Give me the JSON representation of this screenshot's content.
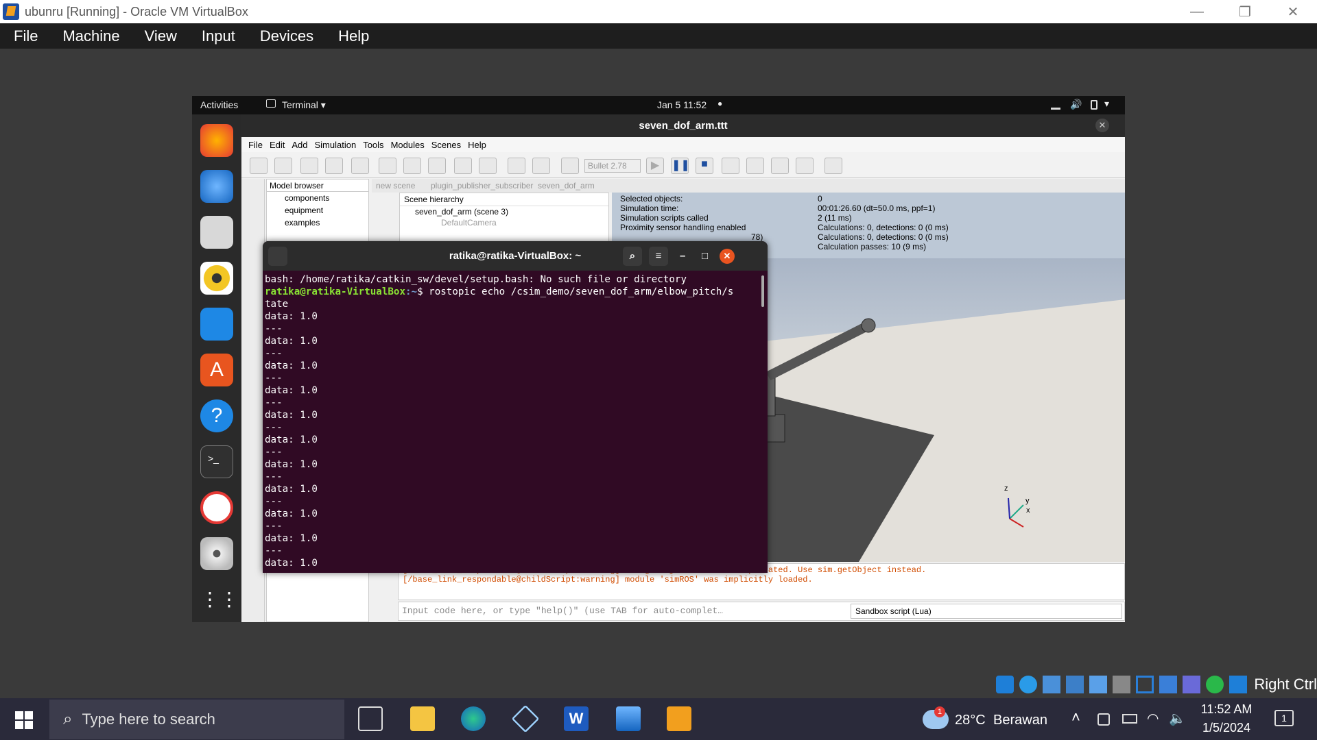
{
  "host_window": {
    "title": "ubunru [Running] - Oracle VM VirtualBox",
    "controls": [
      "—",
      "❐",
      "✕"
    ]
  },
  "host_menu": [
    "File",
    "Machine",
    "View",
    "Input",
    "Devices",
    "Help"
  ],
  "guest_topbar": {
    "activities": "Activities",
    "app": "Terminal ▾",
    "clock": "Jan 5  11:52",
    "dot": "●"
  },
  "coppelia": {
    "title": "seven_dof_arm.ttt",
    "menu": [
      "File",
      "Edit",
      "Add",
      "Simulation",
      "Tools",
      "Modules",
      "Scenes",
      "Help"
    ],
    "engine": "Bullet 2.78",
    "model_browser": {
      "label": "Model browser",
      "items": [
        "components",
        "equipment",
        "examples"
      ]
    },
    "tabs": [
      "new scene",
      "plugin_publisher_subscriber",
      "seven_dof_arm"
    ],
    "scene_hierarchy": {
      "label": "Scene hierarchy",
      "root": "seven_dof_arm (scene 3)",
      "child": "DefaultCamera"
    },
    "info_labels": [
      "Selected objects:",
      "Simulation time:",
      "Simulation scripts called",
      "Proximity sensor handling enabled"
    ],
    "info_values": [
      "0",
      "00:01:26.60 (dt=50.0 ms, ppf=1)",
      "2 (11 ms)",
      "Calculations: 0, detections: 0 (0 ms)",
      "Calculations: 0, detections: 0 (0 ms)",
      "Calculation passes: 10 (9 ms)"
    ],
    "info_hidden": "78)",
    "console": [
      "[/base_link_respondable@childScript:warning] sim.getObjectHandle is deprecated. Use sim.getObject instead.",
      "[/base_link_respondable@childScript:warning] module 'simROS' was implicitly loaded."
    ],
    "cmd_placeholder": "Input code here, or type \"help()\" (use TAB for auto-complet…",
    "script_select": "Sandbox script (Lua)",
    "axes": [
      "z",
      "y",
      "x"
    ]
  },
  "terminal": {
    "title": "ratika@ratika-VirtualBox: ~",
    "line1": "bash: /home/ratika/catkin_sw/devel/setup.bash: No such file or directory",
    "prompt_user": "ratika@ratika-VirtualBox",
    "prompt_path": ":~",
    "prompt_cmd": "$ rostopic echo /csim_demo/seven_dof_arm/elbow_pitch/s",
    "line3": "tate",
    "data": "data: 1.0",
    "sep": "---"
  },
  "host_tray": {
    "right_ctrl": "Right Ctrl"
  },
  "taskbar": {
    "search": "Type here to search",
    "weather_temp": "28°C",
    "weather_text": "Berawan",
    "weather_badge": "1",
    "time": "11:52 AM",
    "date": "1/5/2024",
    "notif": "1"
  }
}
